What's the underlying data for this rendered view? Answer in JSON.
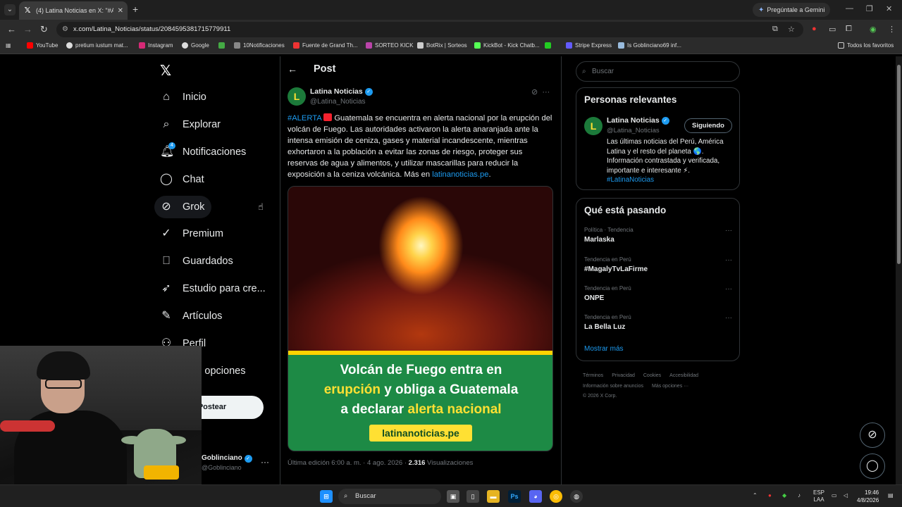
{
  "browser": {
    "tab_title": "(4) Latina Noticias en X: \"#ALERTA",
    "gemini_label": "Pregúntale a Gemini",
    "url": "x.com/Latina_Noticias/status/2084595381715779911",
    "bookmarks": [
      "YouTube",
      "pretium iustum mat...",
      "Instagram",
      "Google",
      "10Notificaciones",
      "Fuente de Grand Th...",
      "SORTEO KICK",
      "BotRix | Sorteos",
      "KickBot - Kick Chatb...",
      "Stripe Express",
      "Is Goblinciano69 inf..."
    ],
    "all_bookmarks": "Todos los favoritos"
  },
  "nav": {
    "items": [
      {
        "label": "Inicio",
        "icon": "home-icon"
      },
      {
        "label": "Explorar",
        "icon": "search-icon"
      },
      {
        "label": "Notificaciones",
        "icon": "bell-icon",
        "badge": "4"
      },
      {
        "label": "Chat",
        "icon": "chat-icon"
      },
      {
        "label": "Grok",
        "icon": "grok-icon"
      },
      {
        "label": "Premium",
        "icon": "premium-icon"
      },
      {
        "label": "Guardados",
        "icon": "bookmark-icon"
      },
      {
        "label": "Estudio para cre...",
        "icon": "rocket-icon"
      },
      {
        "label": "Artículos",
        "icon": "article-icon"
      },
      {
        "label": "Perfil",
        "icon": "user-icon"
      },
      {
        "label": "Más opciones",
        "icon": "more-icon"
      }
    ],
    "post_button": "Postear",
    "account_name": "Goblinciano",
    "account_handle": "@Goblinciano"
  },
  "post": {
    "header_title": "Post",
    "author_name": "Latina Noticias",
    "author_handle": "@Latina_Noticias",
    "hashtag": "#ALERTA",
    "body": "Guatemala se encuentra en alerta nacional por la erupción del volcán de Fuego. Las autoridades activaron la alerta anaranjada ante la intensa emisión de ceniza, gases y material incandescente, mientras exhortaron a la población a evitar las zonas de riesgo, proteger sus reservas de agua y alimentos, y utilizar mascarillas para reducir la exposición a la ceniza volcánica. Más en",
    "link": "latinanoticias.pe",
    "media_headline": {
      "l1a": "Volcán de Fuego entra en",
      "l2a": "erupción",
      "l2b": " y obliga a Guatemala",
      "l3a": "a declarar ",
      "l3b": "alerta nacional"
    },
    "media_site": "latinanoticias.pe",
    "meta_prefix": "Última edición 6:00 a. m. · 4 ago. 2026 · ",
    "views_count": "2.316",
    "views_label": " Visualizaciones"
  },
  "sidebar": {
    "search_placeholder": "Buscar",
    "relevant_title": "Personas relevantes",
    "relevant": {
      "name": "Latina Noticias",
      "handle": "@Latina_Noticias",
      "follow_label": "Siguiendo",
      "bio": "Las últimas noticias del Perú, América Latina y el resto del planeta 🌎. Información contrastada y verificada, importante e interesante ⚡.",
      "bio_tag": "#LatinaNoticias"
    },
    "trends_title": "Qué está pasando",
    "trends": [
      {
        "context": "Política · Tendencia",
        "topic": "Marlaska"
      },
      {
        "context": "Tendencia en Perú",
        "topic": "#MagalyTvLaFirme"
      },
      {
        "context": "Tendencia en Perú",
        "topic": "ONPE"
      },
      {
        "context": "Tendencia en Perú",
        "topic": "La Bella Luz"
      }
    ],
    "show_more": "Mostrar más",
    "footer": [
      "Términos",
      "Privacidad",
      "Cookies",
      "Accesibilidad",
      "Información sobre anuncios",
      "Más opciones ···",
      "© 2026 X Corp."
    ]
  },
  "taskbar": {
    "search_label": "Buscar",
    "lang": "ESP",
    "lang2": "LAA",
    "time": "19:46",
    "date": "4/8/2026"
  },
  "colors": {
    "accent": "#1d9bf0",
    "brand_green": "#1d8a45",
    "brand_yellow": "#ffe033"
  }
}
